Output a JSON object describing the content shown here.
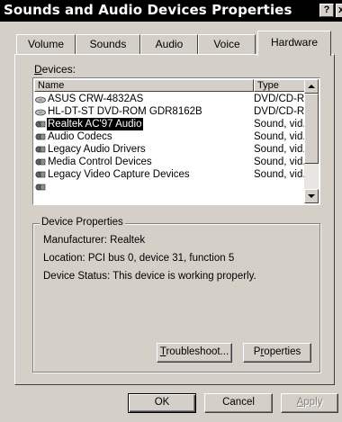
{
  "window": {
    "title": "Sounds and Audio Devices Properties",
    "help_glyph": "?",
    "close_glyph": "x"
  },
  "tabs": [
    {
      "label": "Volume",
      "active": false
    },
    {
      "label": "Sounds",
      "active": false
    },
    {
      "label": "Audio",
      "active": false
    },
    {
      "label": "Voice",
      "active": false
    },
    {
      "label": "Hardware",
      "active": true
    }
  ],
  "devices": {
    "label_accel": "D",
    "label_rest": "evices:",
    "columns": [
      "Name",
      "Type"
    ],
    "rows": [
      {
        "name": "ASUS CRW-4832AS",
        "type": "DVD/CD-R...",
        "icon": "cd-drive-icon",
        "selected": false
      },
      {
        "name": "HL-DT-ST DVD-ROM GDR8162B",
        "type": "DVD/CD-R...",
        "icon": "cd-drive-icon",
        "selected": false
      },
      {
        "name": "Realtek AC'97 Audio",
        "type": "Sound, vid...",
        "icon": "sound-device-icon",
        "selected": true
      },
      {
        "name": "Audio Codecs",
        "type": "Sound, vid...",
        "icon": "sound-device-icon",
        "selected": false
      },
      {
        "name": "Legacy Audio Drivers",
        "type": "Sound, vid...",
        "icon": "sound-device-icon",
        "selected": false
      },
      {
        "name": "Media Control Devices",
        "type": "Sound, vid...",
        "icon": "sound-device-icon",
        "selected": false
      },
      {
        "name": "Legacy Video Capture Devices",
        "type": "Sound, vid...",
        "icon": "sound-device-icon",
        "selected": false
      }
    ]
  },
  "device_properties": {
    "legend": "Device Properties",
    "manufacturer": "Manufacturer: Realtek",
    "location": "Location: PCI bus 0, device 31, function 5",
    "status": "Device Status: This device is working properly."
  },
  "buttons": {
    "troubleshoot_accel": "T",
    "troubleshoot_rest": "roubleshoot...",
    "properties_pre": "P",
    "properties_accel": "r",
    "properties_rest": "operties",
    "ok": "OK",
    "cancel": "Cancel",
    "apply_accel": "A",
    "apply_rest": "pply"
  }
}
